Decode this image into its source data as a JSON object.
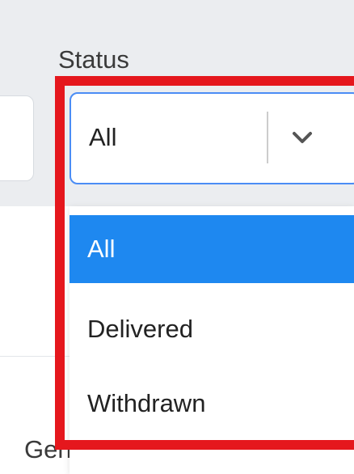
{
  "filter": {
    "label": "Status",
    "selected_value": "All",
    "options": [
      {
        "label": "All",
        "selected": true
      },
      {
        "label": "Delivered",
        "selected": false
      },
      {
        "label": "Withdrawn",
        "selected": false
      }
    ]
  },
  "section": {
    "label": "General"
  },
  "colors": {
    "selected_option": "#1e88f0",
    "focus_border": "#4b8df5",
    "highlight": "#e5171d"
  },
  "icons": {
    "dropdown": "chevron-down-icon"
  }
}
